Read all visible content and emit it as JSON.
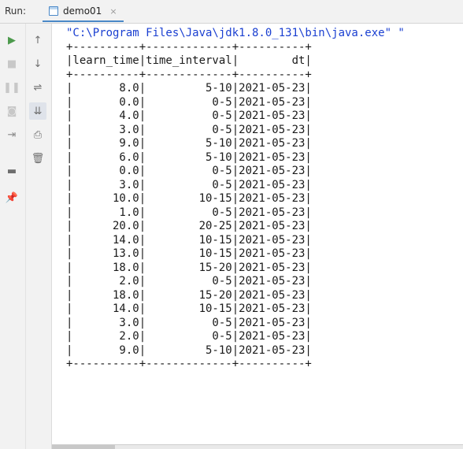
{
  "run_panel": {
    "run_label": "Run:",
    "tab_label": "demo01",
    "tab_close": "×"
  },
  "toolbar": {
    "left": [
      {
        "icon": "play-icon",
        "glyph": "▶",
        "color": "#4c9a4c"
      },
      {
        "icon": "stop-icon",
        "glyph": "■",
        "color": "#c8c8c8"
      },
      {
        "icon": "pause-icon",
        "glyph": "❚❚",
        "color": "#c8c8c8"
      },
      {
        "icon": "camera-icon",
        "glyph": "◙",
        "color": "#c8c8c8"
      },
      {
        "icon": "login-icon",
        "glyph": "⇥",
        "color": "#8a8a8a"
      },
      {
        "icon": "layout-icon",
        "glyph": "▬",
        "color": "#6e6e6e"
      },
      {
        "icon": "pin-icon",
        "glyph": "📌",
        "color": "#6e6e6e"
      }
    ],
    "right": [
      {
        "icon": "arrow-up-icon",
        "glyph": "↑"
      },
      {
        "icon": "arrow-down-icon",
        "glyph": "↓"
      },
      {
        "icon": "soft-wrap-icon",
        "glyph": "⇌"
      },
      {
        "icon": "scroll-to-end-icon",
        "glyph": "⇊",
        "active": true
      },
      {
        "icon": "print-icon",
        "glyph": "⎙"
      },
      {
        "icon": "trash-icon",
        "glyph": "🗑"
      }
    ]
  },
  "console": {
    "command": "\"C:\\Program Files\\Java\\jdk1.8.0_131\\bin\\java.exe\" \"",
    "separator": "+----------+-------------+----------+",
    "header": "|learn_time|time_interval|        dt|",
    "columns": [
      "learn_time",
      "time_interval",
      "dt"
    ],
    "rows": [
      [
        "8.0",
        "5-10",
        "2021-05-23"
      ],
      [
        "0.0",
        "0-5",
        "2021-05-23"
      ],
      [
        "4.0",
        "0-5",
        "2021-05-23"
      ],
      [
        "3.0",
        "0-5",
        "2021-05-23"
      ],
      [
        "9.0",
        "5-10",
        "2021-05-23"
      ],
      [
        "6.0",
        "5-10",
        "2021-05-23"
      ],
      [
        "0.0",
        "0-5",
        "2021-05-23"
      ],
      [
        "3.0",
        "0-5",
        "2021-05-23"
      ],
      [
        "10.0",
        "10-15",
        "2021-05-23"
      ],
      [
        "1.0",
        "0-5",
        "2021-05-23"
      ],
      [
        "20.0",
        "20-25",
        "2021-05-23"
      ],
      [
        "14.0",
        "10-15",
        "2021-05-23"
      ],
      [
        "13.0",
        "10-15",
        "2021-05-23"
      ],
      [
        "18.0",
        "15-20",
        "2021-05-23"
      ],
      [
        "2.0",
        "0-5",
        "2021-05-23"
      ],
      [
        "18.0",
        "15-20",
        "2021-05-23"
      ],
      [
        "14.0",
        "10-15",
        "2021-05-23"
      ],
      [
        "3.0",
        "0-5",
        "2021-05-23"
      ],
      [
        "2.0",
        "0-5",
        "2021-05-23"
      ],
      [
        "9.0",
        "5-10",
        "2021-05-23"
      ]
    ]
  }
}
